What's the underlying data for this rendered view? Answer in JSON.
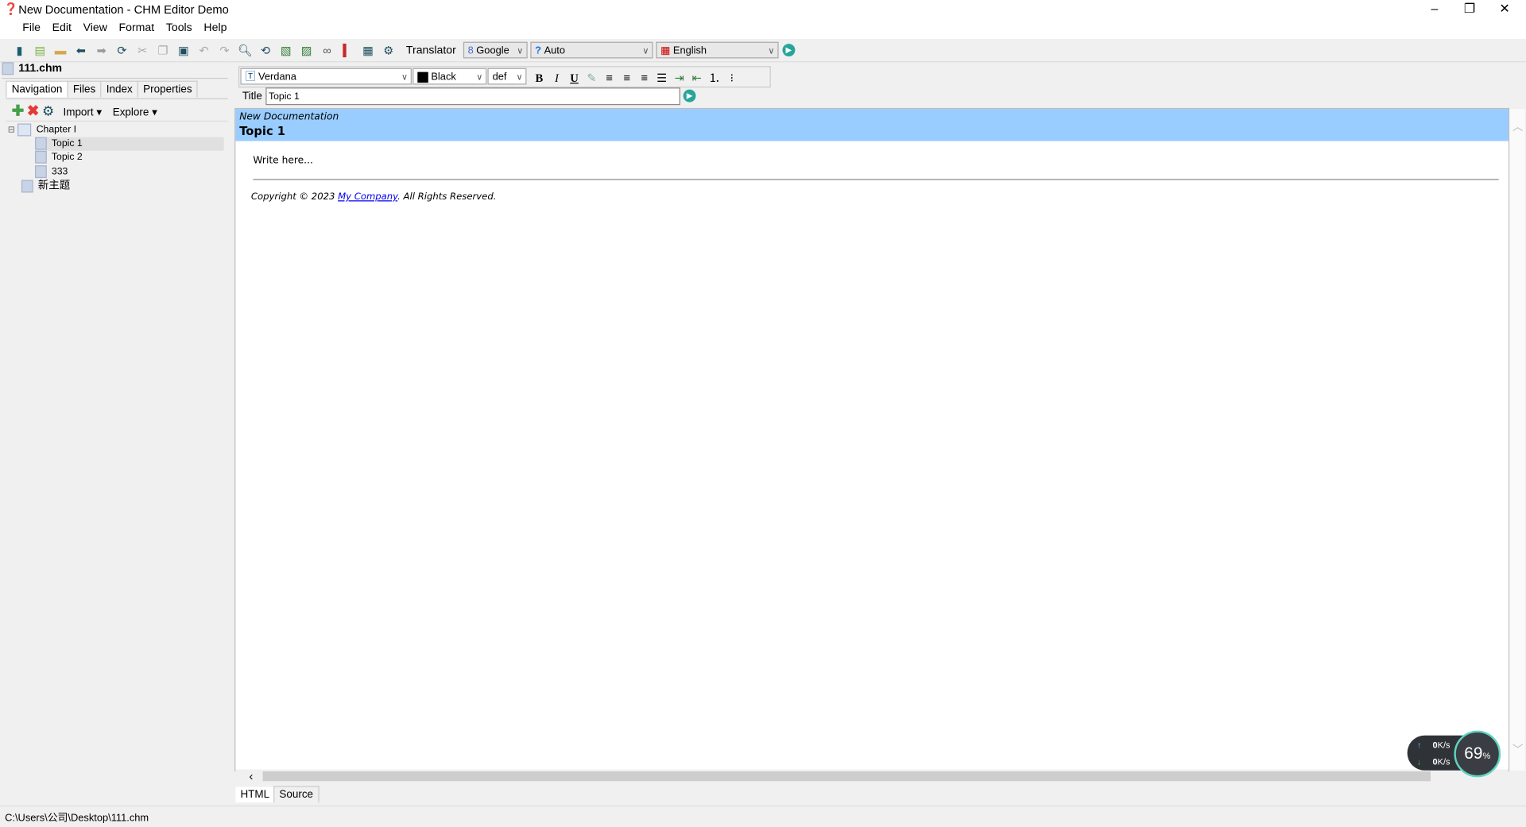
{
  "window": {
    "title": "New Documentation - CHM Editor Demo"
  },
  "menu": [
    "File",
    "Edit",
    "View",
    "Format",
    "Tools",
    "Help"
  ],
  "toolbar": {
    "translator_label": "Translator",
    "engine": "Google",
    "source_lang": "Auto",
    "target_lang": "English"
  },
  "left": {
    "file": "111.chm",
    "tabs": [
      "Navigation",
      "Files",
      "Index",
      "Properties"
    ],
    "import_label": "Import",
    "explore_label": "Explore",
    "tree": [
      {
        "label": "Chapter I",
        "level": 0
      },
      {
        "label": "Topic 1",
        "level": 1,
        "selected": true
      },
      {
        "label": "Topic 2",
        "level": 1
      },
      {
        "label": "333",
        "level": 1
      },
      {
        "label": "新主题",
        "level": 0
      }
    ]
  },
  "format": {
    "font": "Verdana",
    "color": "Black",
    "size": "def"
  },
  "title_field": {
    "label": "Title",
    "value": "Topic 1"
  },
  "document": {
    "header_small": "New Documentation",
    "header_title": "Topic 1",
    "body": "Write here...",
    "copyright_pre": "Copyright © 2023 ",
    "company": "My Company",
    "copyright_post": ". All Rights Reserved.",
    "header_color": "#99ccff"
  },
  "bottom_tabs": [
    "HTML",
    "Source"
  ],
  "statusbar": {
    "path": "C:\\Users\\公司\\Desktop\\111.chm"
  },
  "netmeter": {
    "up": "0",
    "down": "0",
    "unit": "K/s",
    "percent": "69",
    "percent_unit": "%"
  }
}
